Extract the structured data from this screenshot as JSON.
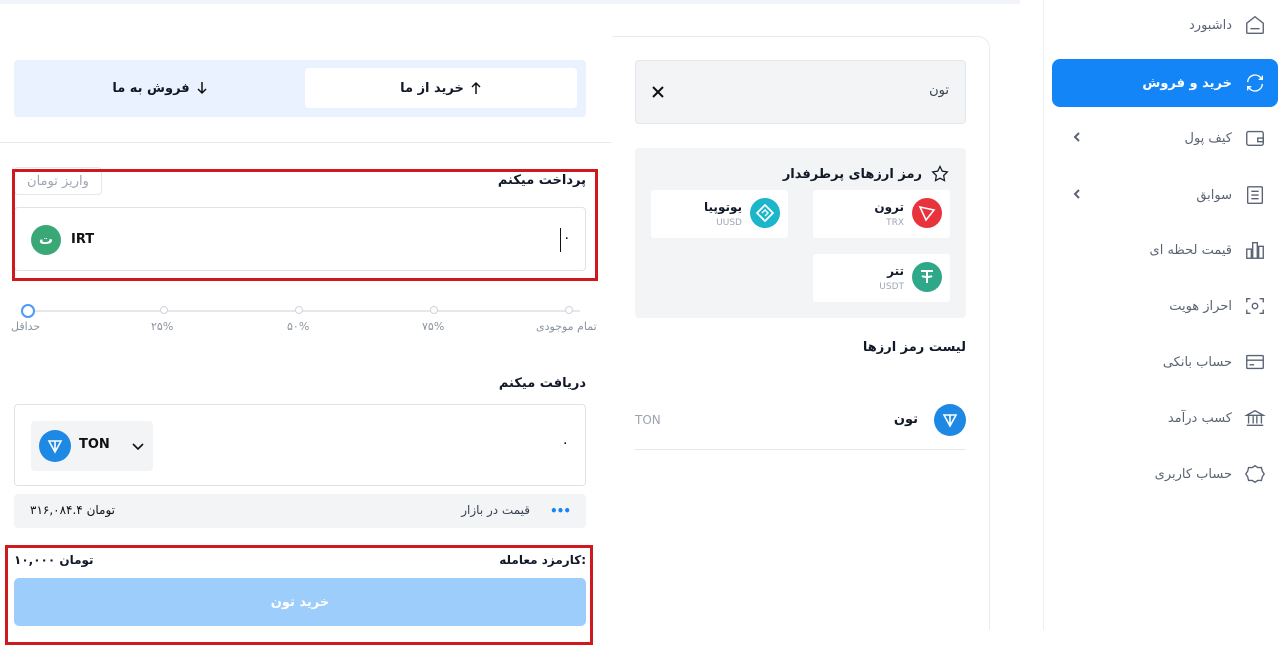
{
  "sidebar": {
    "items": [
      {
        "label": "داشبورد",
        "icon": "home-icon",
        "active": false,
        "expandable": false
      },
      {
        "label": "خرید و فروش",
        "icon": "exchange-icon",
        "active": true,
        "expandable": false
      },
      {
        "label": "کیف پول",
        "icon": "wallet-icon",
        "active": false,
        "expandable": true
      },
      {
        "label": "سوابق",
        "icon": "history-icon",
        "active": false,
        "expandable": true
      },
      {
        "label": "قیمت لحظه ای",
        "icon": "chart-icon",
        "active": false,
        "expandable": false
      },
      {
        "label": "احراز هویت",
        "icon": "scan-icon",
        "active": false,
        "expandable": false
      },
      {
        "label": "حساب بانکی",
        "icon": "card-icon",
        "active": false,
        "expandable": false
      },
      {
        "label": "کسب درآمد",
        "icon": "bank-icon",
        "active": false,
        "expandable": false
      },
      {
        "label": "حساب کاربری",
        "icon": "user-shape-icon",
        "active": false,
        "expandable": false
      }
    ],
    "accent": "#1485f6"
  },
  "search": {
    "value": "تون"
  },
  "favorites": {
    "title": "رمز ارزهای پرطرفدار",
    "coins": [
      {
        "name": "ترون",
        "symbol": "TRX",
        "color": "#e8323c"
      },
      {
        "name": "یوتوپیا",
        "symbol": "UUSD",
        "color": "#1cb5c9"
      },
      {
        "name": "تتر",
        "symbol": "USDT",
        "color": "#2fa889"
      }
    ]
  },
  "coin_list": {
    "title": "لیست رمز ارزها",
    "rows": [
      {
        "name": "تون",
        "symbol": "TON",
        "color": "#1e88e5"
      }
    ]
  },
  "tabs": {
    "buy": "خرید از ما",
    "sell": "فروش به ما"
  },
  "pay": {
    "label": "پرداخت میکنم",
    "deposit_link": "واریز تومان",
    "amount": "۰",
    "currency": "IRT",
    "currency_glyph": "ت"
  },
  "slider": {
    "value_percent": 0,
    "labels": [
      "تمام موجودی",
      "۷۵%",
      "۵۰%",
      "۲۵%",
      "حداقل"
    ]
  },
  "receive": {
    "label": "دریافت میکنم",
    "amount": "۰",
    "currency": "TON"
  },
  "market": {
    "label": "قیمت در بازار",
    "price": "۳۱۶,۰۸۴.۴ تومان"
  },
  "fee": {
    "label": "کارمزد معامله:",
    "value": "۱۰,۰۰۰ تومان"
  },
  "buy_button": "خرید تون"
}
